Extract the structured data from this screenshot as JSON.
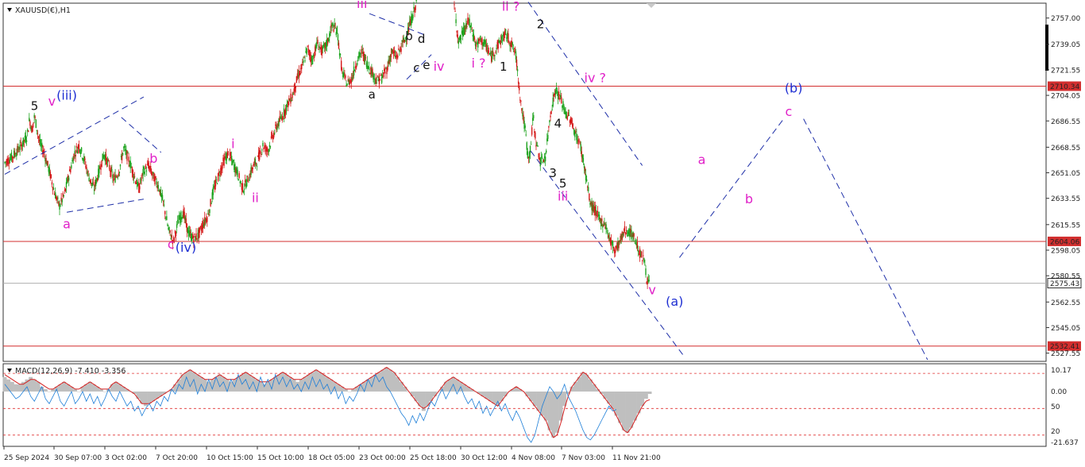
{
  "chart_data": [
    {
      "type": "candlestick",
      "symbol_label": "XAUUSD(€),H1",
      "ylim": [
        2523,
        2765
      ],
      "y_ticks": [
        "2757.00",
        "2739.05",
        "2721.55",
        "2704.05",
        "2686.55",
        "2668.55",
        "2651.05",
        "2633.55",
        "2615.55",
        "2598.05",
        "2580.55",
        "2562.55",
        "2545.05",
        "2527.55"
      ],
      "x_ticks": [
        "25 Sep 2024",
        "30 Sep 07:00",
        "3 Oct 02:00",
        "7 Oct 20:00",
        "10 Oct 15:00",
        "15 Oct 10:00",
        "18 Oct 05:00",
        "23 Oct 00:00",
        "25 Oct 18:00",
        "30 Oct 12:00",
        "4 Nov 08:00",
        "7 Nov 03:00",
        "11 Nov 21:00"
      ],
      "levels": [
        {
          "value": "2710.34",
          "color": "#d32f2f"
        },
        {
          "value": "2604.06",
          "color": "#d32f2f"
        },
        {
          "value": "2532.41",
          "color": "#d32f2f"
        }
      ],
      "current_price": "2575.43",
      "price_path": [
        [
          0,
          2658
        ],
        [
          3,
          2662
        ],
        [
          6,
          2668
        ],
        [
          9,
          2676
        ],
        [
          10,
          2688
        ],
        [
          11,
          2680
        ],
        [
          12,
          2690
        ],
        [
          14,
          2672
        ],
        [
          16,
          2664
        ],
        [
          18,
          2652
        ],
        [
          20,
          2638
        ],
        [
          22,
          2628
        ],
        [
          24,
          2636
        ],
        [
          26,
          2650
        ],
        [
          28,
          2664
        ],
        [
          30,
          2670
        ],
        [
          32,
          2660
        ],
        [
          34,
          2648
        ],
        [
          36,
          2640
        ],
        [
          38,
          2652
        ],
        [
          40,
          2664
        ],
        [
          42,
          2656
        ],
        [
          44,
          2646
        ],
        [
          46,
          2652
        ],
        [
          48,
          2668
        ],
        [
          50,
          2660
        ],
        [
          52,
          2650
        ],
        [
          54,
          2640
        ],
        [
          56,
          2652
        ],
        [
          58,
          2656
        ],
        [
          60,
          2648
        ],
        [
          62,
          2642
        ],
        [
          64,
          2630
        ],
        [
          66,
          2612
        ],
        [
          68,
          2604
        ],
        [
          70,
          2618
        ],
        [
          72,
          2624
        ],
        [
          74,
          2610
        ],
        [
          76,
          2606
        ],
        [
          78,
          2608
        ],
        [
          80,
          2616
        ],
        [
          82,
          2622
        ],
        [
          84,
          2638
        ],
        [
          86,
          2648
        ],
        [
          88,
          2658
        ],
        [
          90,
          2664
        ],
        [
          92,
          2658
        ],
        [
          94,
          2650
        ],
        [
          96,
          2640
        ],
        [
          98,
          2646
        ],
        [
          100,
          2655
        ],
        [
          102,
          2660
        ],
        [
          104,
          2670
        ],
        [
          106,
          2666
        ],
        [
          108,
          2676
        ],
        [
          110,
          2684
        ],
        [
          112,
          2690
        ],
        [
          114,
          2698
        ],
        [
          116,
          2704
        ],
        [
          118,
          2716
        ],
        [
          120,
          2724
        ],
        [
          122,
          2736
        ],
        [
          124,
          2728
        ],
        [
          126,
          2740
        ],
        [
          128,
          2734
        ],
        [
          130,
          2740
        ],
        [
          132,
          2752
        ],
        [
          134,
          2748
        ],
        [
          136,
          2720
        ],
        [
          138,
          2712
        ],
        [
          140,
          2716
        ],
        [
          142,
          2728
        ],
        [
          144,
          2734
        ],
        [
          146,
          2726
        ],
        [
          148,
          2720
        ],
        [
          150,
          2714
        ],
        [
          152,
          2716
        ],
        [
          154,
          2722
        ],
        [
          156,
          2734
        ],
        [
          158,
          2730
        ],
        [
          160,
          2738
        ],
        [
          162,
          2745
        ],
        [
          164,
          2756
        ],
        [
          166,
          2768
        ],
        [
          181,
          2768
        ],
        [
          183,
          2740
        ],
        [
          185,
          2748
        ],
        [
          187,
          2755
        ],
        [
          189,
          2745
        ],
        [
          190,
          2738
        ],
        [
          192,
          2742
        ],
        [
          194,
          2738
        ],
        [
          196,
          2730
        ],
        [
          198,
          2736
        ],
        [
          200,
          2742
        ],
        [
          202,
          2746
        ],
        [
          204,
          2740
        ],
        [
          206,
          2732
        ],
        [
          208,
          2700
        ],
        [
          210,
          2678
        ],
        [
          211,
          2660
        ],
        [
          212,
          2668
        ],
        [
          213,
          2690
        ],
        [
          214,
          2674
        ],
        [
          216,
          2658
        ],
        [
          218,
          2662
        ],
        [
          220,
          2692
        ],
        [
          222,
          2708
        ],
        [
          224,
          2702
        ],
        [
          226,
          2692
        ],
        [
          228,
          2688
        ],
        [
          230,
          2678
        ],
        [
          232,
          2670
        ],
        [
          234,
          2652
        ],
        [
          236,
          2630
        ],
        [
          238,
          2625
        ],
        [
          240,
          2618
        ],
        [
          242,
          2616
        ],
        [
          244,
          2605
        ],
        [
          246,
          2598
        ],
        [
          248,
          2604
        ],
        [
          250,
          2612
        ],
        [
          252,
          2610
        ],
        [
          254,
          2606
        ],
        [
          256,
          2596
        ],
        [
          258,
          2590
        ],
        [
          259,
          2576
        ],
        [
          260,
          2575.43
        ]
      ],
      "wave_labels": [
        {
          "text": "5",
          "color": "#111111",
          "x": 12,
          "y": 2694
        },
        {
          "text": "v",
          "color": "#e020c8",
          "x": 19,
          "y": 2697
        },
        {
          "text": "(iii)",
          "color": "#1e2fd2",
          "x": 25,
          "y": 2701
        },
        {
          "text": "a",
          "color": "#e020c8",
          "x": 25,
          "y": 2613
        },
        {
          "text": "b",
          "color": "#e020c8",
          "x": 60,
          "y": 2658
        },
        {
          "text": "c",
          "color": "#e020c8",
          "x": 67,
          "y": 2599
        },
        {
          "text": "(iv)",
          "color": "#1e2fd2",
          "x": 73,
          "y": 2597
        },
        {
          "text": "i",
          "color": "#e020c8",
          "x": 92,
          "y": 2668
        },
        {
          "text": "ii",
          "color": "#e020c8",
          "x": 101,
          "y": 2631
        },
        {
          "text": "iii",
          "color": "#e020c8",
          "x": 144,
          "y": 2764
        },
        {
          "text": "a",
          "color": "#111111",
          "x": 148,
          "y": 2702
        },
        {
          "text": "b",
          "color": "#111111",
          "x": 163,
          "y": 2742
        },
        {
          "text": "d",
          "color": "#111111",
          "x": 168,
          "y": 2740
        },
        {
          "text": "c",
          "color": "#111111",
          "x": 166,
          "y": 2720
        },
        {
          "text": "e",
          "color": "#111111",
          "x": 170,
          "y": 2722
        },
        {
          "text": "iv",
          "color": "#e020c8",
          "x": 175,
          "y": 2721
        },
        {
          "text": "i ?",
          "color": "#e020c8",
          "x": 191,
          "y": 2723
        },
        {
          "text": "ii ?",
          "color": "#e020c8",
          "x": 204,
          "y": 2762
        },
        {
          "text": "1",
          "color": "#111111",
          "x": 201,
          "y": 2721
        },
        {
          "text": "2",
          "color": "#111111",
          "x": 216,
          "y": 2750
        },
        {
          "text": "iv ?",
          "color": "#e020c8",
          "x": 238,
          "y": 2713
        },
        {
          "text": "4",
          "color": "#111111",
          "x": 223,
          "y": 2682
        },
        {
          "text": "3",
          "color": "#111111",
          "x": 221,
          "y": 2648
        },
        {
          "text": "5",
          "color": "#111111",
          "x": 225,
          "y": 2641
        },
        {
          "text": "iii",
          "color": "#e020c8",
          "x": 225,
          "y": 2632
        },
        {
          "text": "v",
          "color": "#e020c8",
          "x": 261,
          "y": 2568
        },
        {
          "text": "(a)",
          "color": "#1e2fd2",
          "x": 270,
          "y": 2560
        },
        {
          "text": "a",
          "color": "#e020c8",
          "x": 281,
          "y": 2657
        },
        {
          "text": "b",
          "color": "#e020c8",
          "x": 300,
          "y": 2630
        },
        {
          "text": "(b)",
          "color": "#1e2fd2",
          "x": 318,
          "y": 2706
        },
        {
          "text": "c",
          "color": "#e020c8",
          "x": 316,
          "y": 2690
        }
      ],
      "channel_lines": [
        [
          [
            0,
            2650
          ],
          [
            56,
            2703
          ]
        ],
        [
          [
            25,
            2624
          ],
          [
            56,
            2633
          ]
        ],
        [
          [
            47,
            2689
          ],
          [
            63,
            2665
          ]
        ],
        [
          [
            147,
            2760
          ],
          [
            170,
            2745
          ]
        ],
        [
          [
            162,
            2715
          ],
          [
            172,
            2732
          ]
        ],
        [
          [
            211,
            2768
          ],
          [
            257,
            2656
          ]
        ],
        [
          [
            212,
            2666
          ],
          [
            274,
            2525
          ]
        ],
        [
          [
            272,
            2593
          ],
          [
            314,
            2688
          ]
        ],
        [
          [
            322,
            2688
          ],
          [
            372,
            2523
          ]
        ]
      ]
    },
    {
      "type": "histogram+line",
      "label": "MACD(12,26,9) -7.410 -3.356",
      "ylim": [
        -22,
        10.17
      ],
      "y_ticks": [
        "10.17",
        "0.00",
        "50",
        "20",
        "-21.637"
      ],
      "hlines": [
        7.5,
        -7,
        -18
      ],
      "hist": [
        6,
        5,
        4,
        3,
        3,
        4,
        5,
        6,
        5,
        4,
        2,
        1,
        0,
        1,
        2,
        3,
        4,
        3,
        2,
        1,
        0,
        2,
        3,
        4,
        3,
        2,
        1,
        0,
        1,
        3,
        4,
        3,
        2,
        1,
        0,
        -1,
        -3,
        -5,
        -6,
        -5,
        -4,
        -3,
        -2,
        -1,
        0,
        1,
        3,
        5,
        7,
        8,
        9,
        8,
        7,
        6,
        5,
        4,
        5,
        6,
        7,
        6,
        5,
        4,
        5,
        6,
        7,
        8,
        7,
        6,
        5,
        4,
        3,
        4,
        5,
        6,
        7,
        8,
        7,
        6,
        5,
        4,
        5,
        6,
        7,
        8,
        9,
        8,
        7,
        6,
        5,
        4,
        3,
        2,
        1,
        0,
        1,
        2,
        3,
        4,
        5,
        6,
        7,
        8,
        9,
        10,
        9,
        8,
        6,
        4,
        2,
        0,
        -2,
        -4,
        -6,
        -8,
        -6,
        -4,
        -2,
        0,
        2,
        4,
        5,
        6,
        5,
        4,
        3,
        2,
        1,
        0,
        -1,
        -2,
        -3,
        -4,
        -5,
        -6,
        -4,
        -2,
        0,
        1,
        2,
        1,
        0,
        -2,
        -4,
        -6,
        -8,
        -10,
        -12,
        -16,
        -19,
        -17,
        -12,
        -6,
        -1,
        2,
        4,
        6,
        8,
        7,
        5,
        3,
        1,
        -1,
        -3,
        -5,
        -7,
        -10,
        -13,
        -16,
        -17,
        -15,
        -12,
        -9,
        -6,
        -3,
        -1
      ],
      "signal": [
        7,
        6,
        5,
        4,
        3,
        3,
        4,
        5,
        5,
        4,
        3,
        2,
        1,
        1,
        2,
        3,
        4,
        3,
        2,
        1,
        1,
        2,
        3,
        4,
        3,
        2,
        1,
        1,
        1,
        3,
        4,
        3,
        2,
        1,
        0,
        -1,
        -3,
        -5,
        -5,
        -5,
        -4,
        -3,
        -2,
        -1,
        0,
        1,
        3,
        5,
        7,
        8,
        9,
        8,
        7,
        6,
        5,
        5,
        5,
        6,
        7,
        6,
        5,
        5,
        5,
        6,
        7,
        8,
        7,
        6,
        5,
        4,
        4,
        4,
        5,
        6,
        7,
        8,
        7,
        6,
        5,
        5,
        5,
        6,
        7,
        8,
        9,
        8,
        7,
        6,
        5,
        4,
        3,
        2,
        1,
        1,
        1,
        2,
        3,
        4,
        5,
        6,
        7,
        8,
        9,
        10,
        9,
        8,
        6,
        4,
        2,
        0,
        -2,
        -4,
        -6,
        -7,
        -6,
        -4,
        -2,
        0,
        2,
        4,
        5,
        6,
        5,
        4,
        3,
        2,
        1,
        0,
        -1,
        -2,
        -3,
        -4,
        -5,
        -6,
        -4,
        -2,
        0,
        1,
        2,
        1,
        0,
        -2,
        -4,
        -6,
        -8,
        -10,
        -12,
        -16,
        -19,
        -18,
        -13,
        -7,
        -2,
        2,
        4,
        6,
        8,
        7,
        5,
        3,
        1,
        -1,
        -3,
        -5,
        -7,
        -10,
        -13,
        -16,
        -17,
        -15,
        -12,
        -9,
        -6,
        -4,
        -3.356
      ],
      "macd": [
        3,
        1,
        -1,
        -3,
        -2,
        0,
        2,
        -2,
        -4,
        -1,
        2,
        -3,
        -5,
        -2,
        1,
        -4,
        -6,
        -3,
        0,
        -5,
        -3,
        0,
        -4,
        -1,
        -5,
        -2,
        -6,
        -3,
        1,
        -2,
        -4,
        0,
        -3,
        -6,
        -4,
        -8,
        -6,
        -10,
        -7,
        -5,
        -8,
        -4,
        -6,
        -2,
        -4,
        1,
        -1,
        3,
        1,
        6,
        2,
        5,
        -1,
        3,
        0,
        5,
        1,
        6,
        2,
        4,
        0,
        5,
        2,
        7,
        3,
        5,
        1,
        4,
        0,
        6,
        2,
        5,
        1,
        7,
        3,
        6,
        2,
        5,
        1,
        3,
        0,
        4,
        1,
        6,
        2,
        5,
        1,
        3,
        -1,
        2,
        -3,
        0,
        -5,
        -2,
        -4,
        -1,
        3,
        0,
        5,
        2,
        7,
        4,
        6,
        2,
        0,
        -3,
        -6,
        -9,
        -11,
        -14,
        -10,
        -13,
        -9,
        -12,
        -8,
        -4,
        -6,
        -2,
        1,
        -3,
        0,
        3,
        -1,
        2,
        -2,
        -5,
        -3,
        -7,
        -4,
        -9,
        -6,
        -10,
        -7,
        -4,
        -8,
        -5,
        -9,
        -12,
        -8,
        -11,
        -15,
        -19,
        -21,
        -18,
        -12,
        -6,
        -2,
        2,
        0,
        -3,
        -1,
        3,
        -2,
        -5,
        -8,
        -12,
        -16,
        -19,
        -20,
        -18,
        -15,
        -12,
        -9,
        -6,
        -8,
        -7.41
      ]
    }
  ]
}
